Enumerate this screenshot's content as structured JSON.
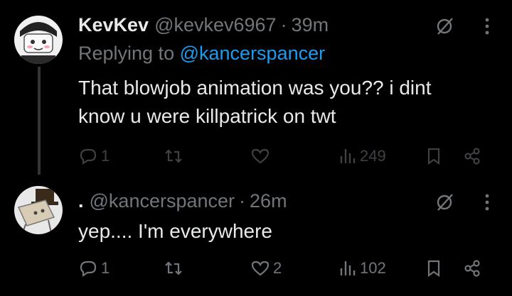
{
  "tweets": [
    {
      "display_name": "KevKev",
      "handle": "@kevkev6967",
      "separator": "·",
      "time": "39m",
      "replying_prefix": "Replying to",
      "replying_to": "@kancerspancer",
      "text_line1": "That blowjob animation was you?? i dint",
      "text_line2": "know u were killpatrick on twt",
      "reply_count": "1",
      "repost_count": "",
      "like_count": "",
      "view_count": "249"
    },
    {
      "display_name": ".",
      "handle": "@kancerspancer",
      "separator": "·",
      "time": "26m",
      "text_line1": "yep.... I'm everywhere",
      "reply_count": "1",
      "repost_count": "",
      "like_count": "2",
      "view_count": "102"
    }
  ],
  "icons": [
    "avatar",
    "grok-icon",
    "more-icon",
    "reply-icon",
    "repost-icon",
    "like-icon",
    "views-icon",
    "bookmark-icon",
    "share-icon"
  ],
  "colors": {
    "background": "#000000",
    "text": "#e7e9ea",
    "muted": "#71767b",
    "accent": "#1d9bf0",
    "thread_line": "#333639"
  }
}
